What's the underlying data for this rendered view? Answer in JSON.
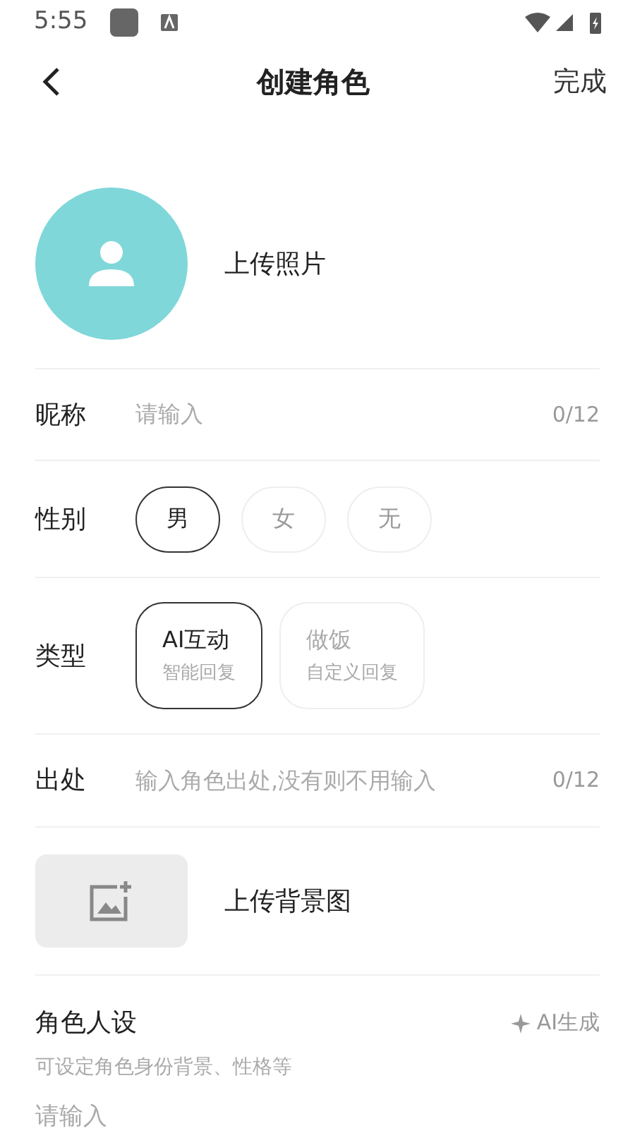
{
  "status_bar": {
    "time": "5:55"
  },
  "header": {
    "title": "创建角色",
    "action": "完成"
  },
  "avatar": {
    "label": "上传照片"
  },
  "nickname": {
    "label": "昵称",
    "placeholder": "请输入",
    "counter": "0/12"
  },
  "gender": {
    "label": "性别",
    "options": [
      {
        "label": "男",
        "selected": true
      },
      {
        "label": "女",
        "selected": false
      },
      {
        "label": "无",
        "selected": false
      }
    ]
  },
  "type": {
    "label": "类型",
    "options": [
      {
        "title": "AI互动",
        "subtitle": "智能回复",
        "selected": true
      },
      {
        "title": "做饭",
        "subtitle": "自定义回复",
        "selected": false
      }
    ]
  },
  "origin": {
    "label": "出处",
    "placeholder": "输入角色出处,没有则不用输入",
    "counter": "0/12"
  },
  "background": {
    "label": "上传背景图"
  },
  "persona": {
    "label": "角色人设",
    "ai_button": "AI生成",
    "hint": "可设定角色身份背景、性格等",
    "placeholder": "请输入"
  }
}
